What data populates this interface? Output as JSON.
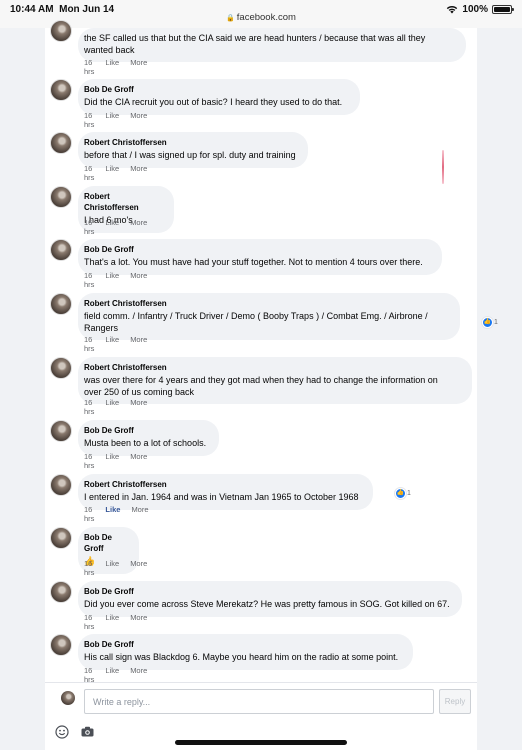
{
  "statusbar": {
    "time": "10:44 AM",
    "date": "Mon Jun 14",
    "url": "facebook.com",
    "battery": "100%"
  },
  "comments": [
    {
      "name": "",
      "text": [
        "the SF called us that but the CIA said we are head hunters / because that was all they",
        "wanted back"
      ],
      "time": "16 hrs",
      "like": "Like",
      "more": "More",
      "liked": false
    },
    {
      "name": "Bob De Groff",
      "text": [
        "Did the CIA recruit you out of basic? I heard they used to do that."
      ],
      "time": "16 hrs",
      "like": "Like",
      "more": "More",
      "liked": false
    },
    {
      "name": "Robert Christoffersen",
      "text": [
        "before that / I was signed up for spl. duty and training"
      ],
      "time": "16 hrs",
      "like": "Like",
      "more": "More",
      "liked": false
    },
    {
      "name": "Robert Christoffersen",
      "text": [
        "I had 6 mo's"
      ],
      "time": "16 hrs",
      "like": "Like",
      "more": "More",
      "liked": false
    },
    {
      "name": "Bob De Groff",
      "text": [
        "That's a lot. You must have had your stuff together. Not to mention 4 tours over there."
      ],
      "time": "16 hrs",
      "like": "Like",
      "more": "More",
      "liked": false
    },
    {
      "name": "Robert Christoffersen",
      "text": [
        "field comm. / Infantry / Truck Driver / Demo ( Booby Traps ) / Combat Emg. / Airbrone /",
        "Rangers"
      ],
      "time": "16 hrs",
      "like": "Like",
      "more": "More",
      "liked": false,
      "reactions": "1"
    },
    {
      "name": "Robert Christoffersen",
      "text": [
        "was over there for 4 years and they got mad when they had to change the information on",
        "over 250 of us coming back"
      ],
      "time": "16 hrs",
      "like": "Like",
      "more": "More",
      "liked": false
    },
    {
      "name": "Bob De Groff",
      "text": [
        "Musta been to a lot of schools."
      ],
      "time": "16 hrs",
      "like": "Like",
      "more": "More",
      "liked": false
    },
    {
      "name": "Robert Christoffersen",
      "text": [
        "I entered in Jan. 1964 and was in Vietnam Jan 1965 to October 1968"
      ],
      "time": "16 hrs",
      "like": "Like",
      "more": "More",
      "liked": true,
      "reactions": "1"
    },
    {
      "name": "Bob De Groff",
      "text": [
        "👍"
      ],
      "time": "16 hrs",
      "like": "Like",
      "more": "More",
      "liked": false
    },
    {
      "name": "Bob De Groff",
      "text": [
        "Did you ever come across Steve Merekatz? He was pretty famous in SOG. Got killed on 67."
      ],
      "time": "16 hrs",
      "like": "Like",
      "more": "More",
      "liked": false
    },
    {
      "name": "Bob De Groff",
      "text": [
        "His call sign was Blackdog 6. Maybe you heard him on the radio at some point."
      ],
      "time": "16 hrs",
      "like": "Like",
      "more": "More",
      "liked": false
    }
  ],
  "reply": {
    "placeholder": "Write a reply...",
    "button": "Reply"
  },
  "icons": {
    "emoji": "smile-icon",
    "camera": "camera-icon",
    "wifi": "wifi-icon",
    "lock": "lock-icon",
    "like_reaction": "thumbs-up-icon"
  },
  "colors": {
    "bubble": "#f0f2f5",
    "link": "#385898",
    "reaction": "#1877f2",
    "meta": "#65676b"
  }
}
